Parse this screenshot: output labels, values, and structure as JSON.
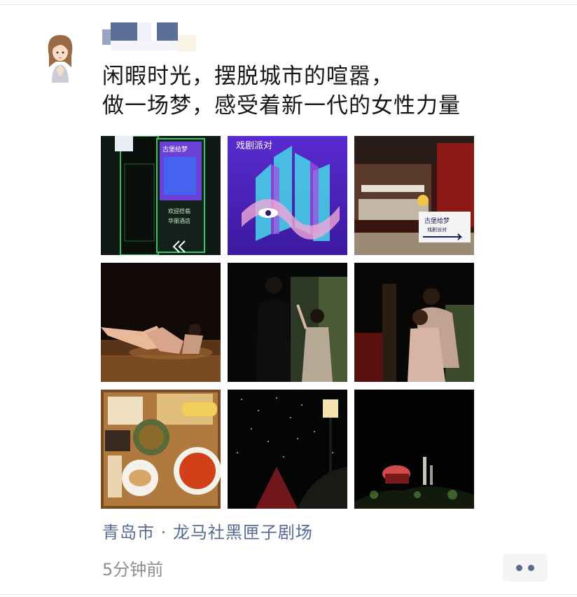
{
  "post": {
    "text_lines": [
      "闲暇时光，摆脱城市的喧嚣，",
      "做一场梦，感受着新一代的女性力量"
    ],
    "location": "青岛市 · 龙马社黑匣子剧场",
    "timestamp": "5分钟前"
  },
  "photos": {
    "p1": {
      "sign_title": "古堡给梦",
      "sign_text_1": "欢迎莅临",
      "sign_text_2": "华丽酒店"
    },
    "p2": {
      "poster_title": "戏剧派对"
    },
    "p3": {
      "sign_title": "古堡给梦",
      "sign_sub": "戏剧派对"
    }
  },
  "colors": {
    "link": "#576b95",
    "text": "#161616",
    "muted": "#8e8e8e"
  }
}
